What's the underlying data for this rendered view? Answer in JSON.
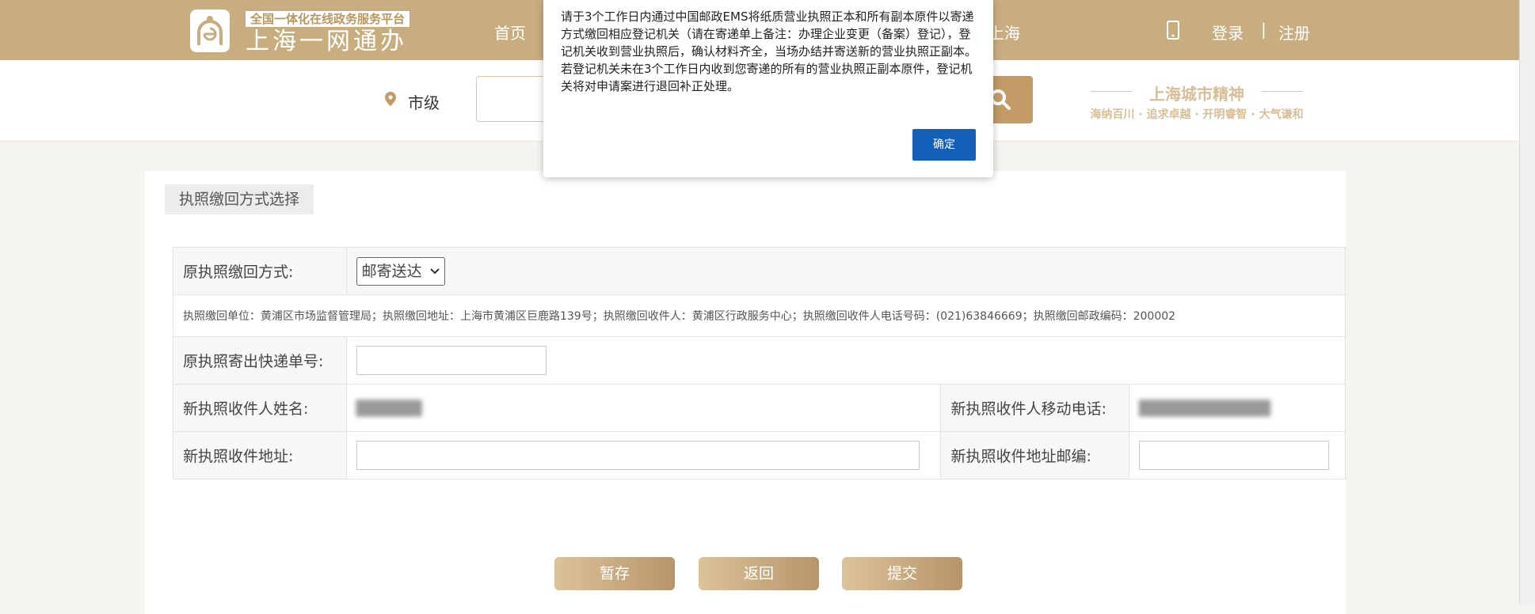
{
  "header": {
    "logo_slogan": "全国一体化在线政务服务平台",
    "logo_name": "上海一网通办",
    "nav_home": "首页",
    "nav_shanghai": "上海",
    "login": "登录",
    "separator": "|",
    "register": "注册"
  },
  "search": {
    "location": "市级",
    "placeholder": "",
    "spirit_title": "上海城市精神",
    "spirit_sub": "海纳百川 · 追求卓越 · 开明睿智 · 大气谦和"
  },
  "section": {
    "title": "执照缴回方式选择"
  },
  "form": {
    "return_method_label": "原执照缴回方式:",
    "return_method_value": "邮寄送达",
    "return_note": "执照缴回单位：黄浦区市场监督管理局；执照缴回地址：上海市黄浦区巨鹿路139号；执照缴回收件人：黄浦区行政服务中心；执照缴回收件人电话号码：(021)63846669；执照缴回邮政编码：200002",
    "tracking_label": "原执照寄出快递单号:",
    "tracking_value": "",
    "recipient_name_label": "新执照收件人姓名:",
    "recipient_name_value": "██████",
    "recipient_phone_label": "新执照收件人移动电话:",
    "recipient_phone_value": "████████████",
    "address_label": "新执照收件地址:",
    "address_value": "",
    "postcode_label": "新执照收件地址邮编:",
    "postcode_value": ""
  },
  "buttons": {
    "save": "暂存",
    "back": "返回",
    "submit": "提交"
  },
  "modal": {
    "message": "请于3个工作日内通过中国邮政EMS将纸质营业执照正本和所有副本原件以寄递方式缴回相应登记机关（请在寄递单上备注：办理企业变更（备案）登记），登记机关收到营业执照后，确认材料齐全，当场办结并寄送新的营业执照正副本。若登记机关未在3个工作日内收到您寄递的所有的营业执照正副本原件，登记机关将对申请案进行退回补正处理。",
    "ok": "确定"
  },
  "colors": {
    "brand": "#c8ad7f",
    "button": "#1460b9"
  }
}
